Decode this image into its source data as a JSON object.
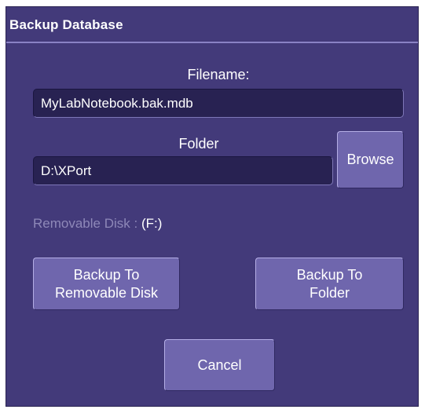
{
  "window": {
    "title": "Backup Database"
  },
  "filename": {
    "label": "Filename:",
    "value": "MyLabNotebook.bak.mdb"
  },
  "folder": {
    "label": "Folder",
    "value": "D:\\XPort",
    "browse_label": "Browse"
  },
  "removable_disk": {
    "label": "Removable Disk :",
    "value": "(F:)"
  },
  "buttons": {
    "backup_removable": "Backup To\nRemovable Disk",
    "backup_folder": "Backup To\nFolder",
    "cancel": "Cancel"
  }
}
